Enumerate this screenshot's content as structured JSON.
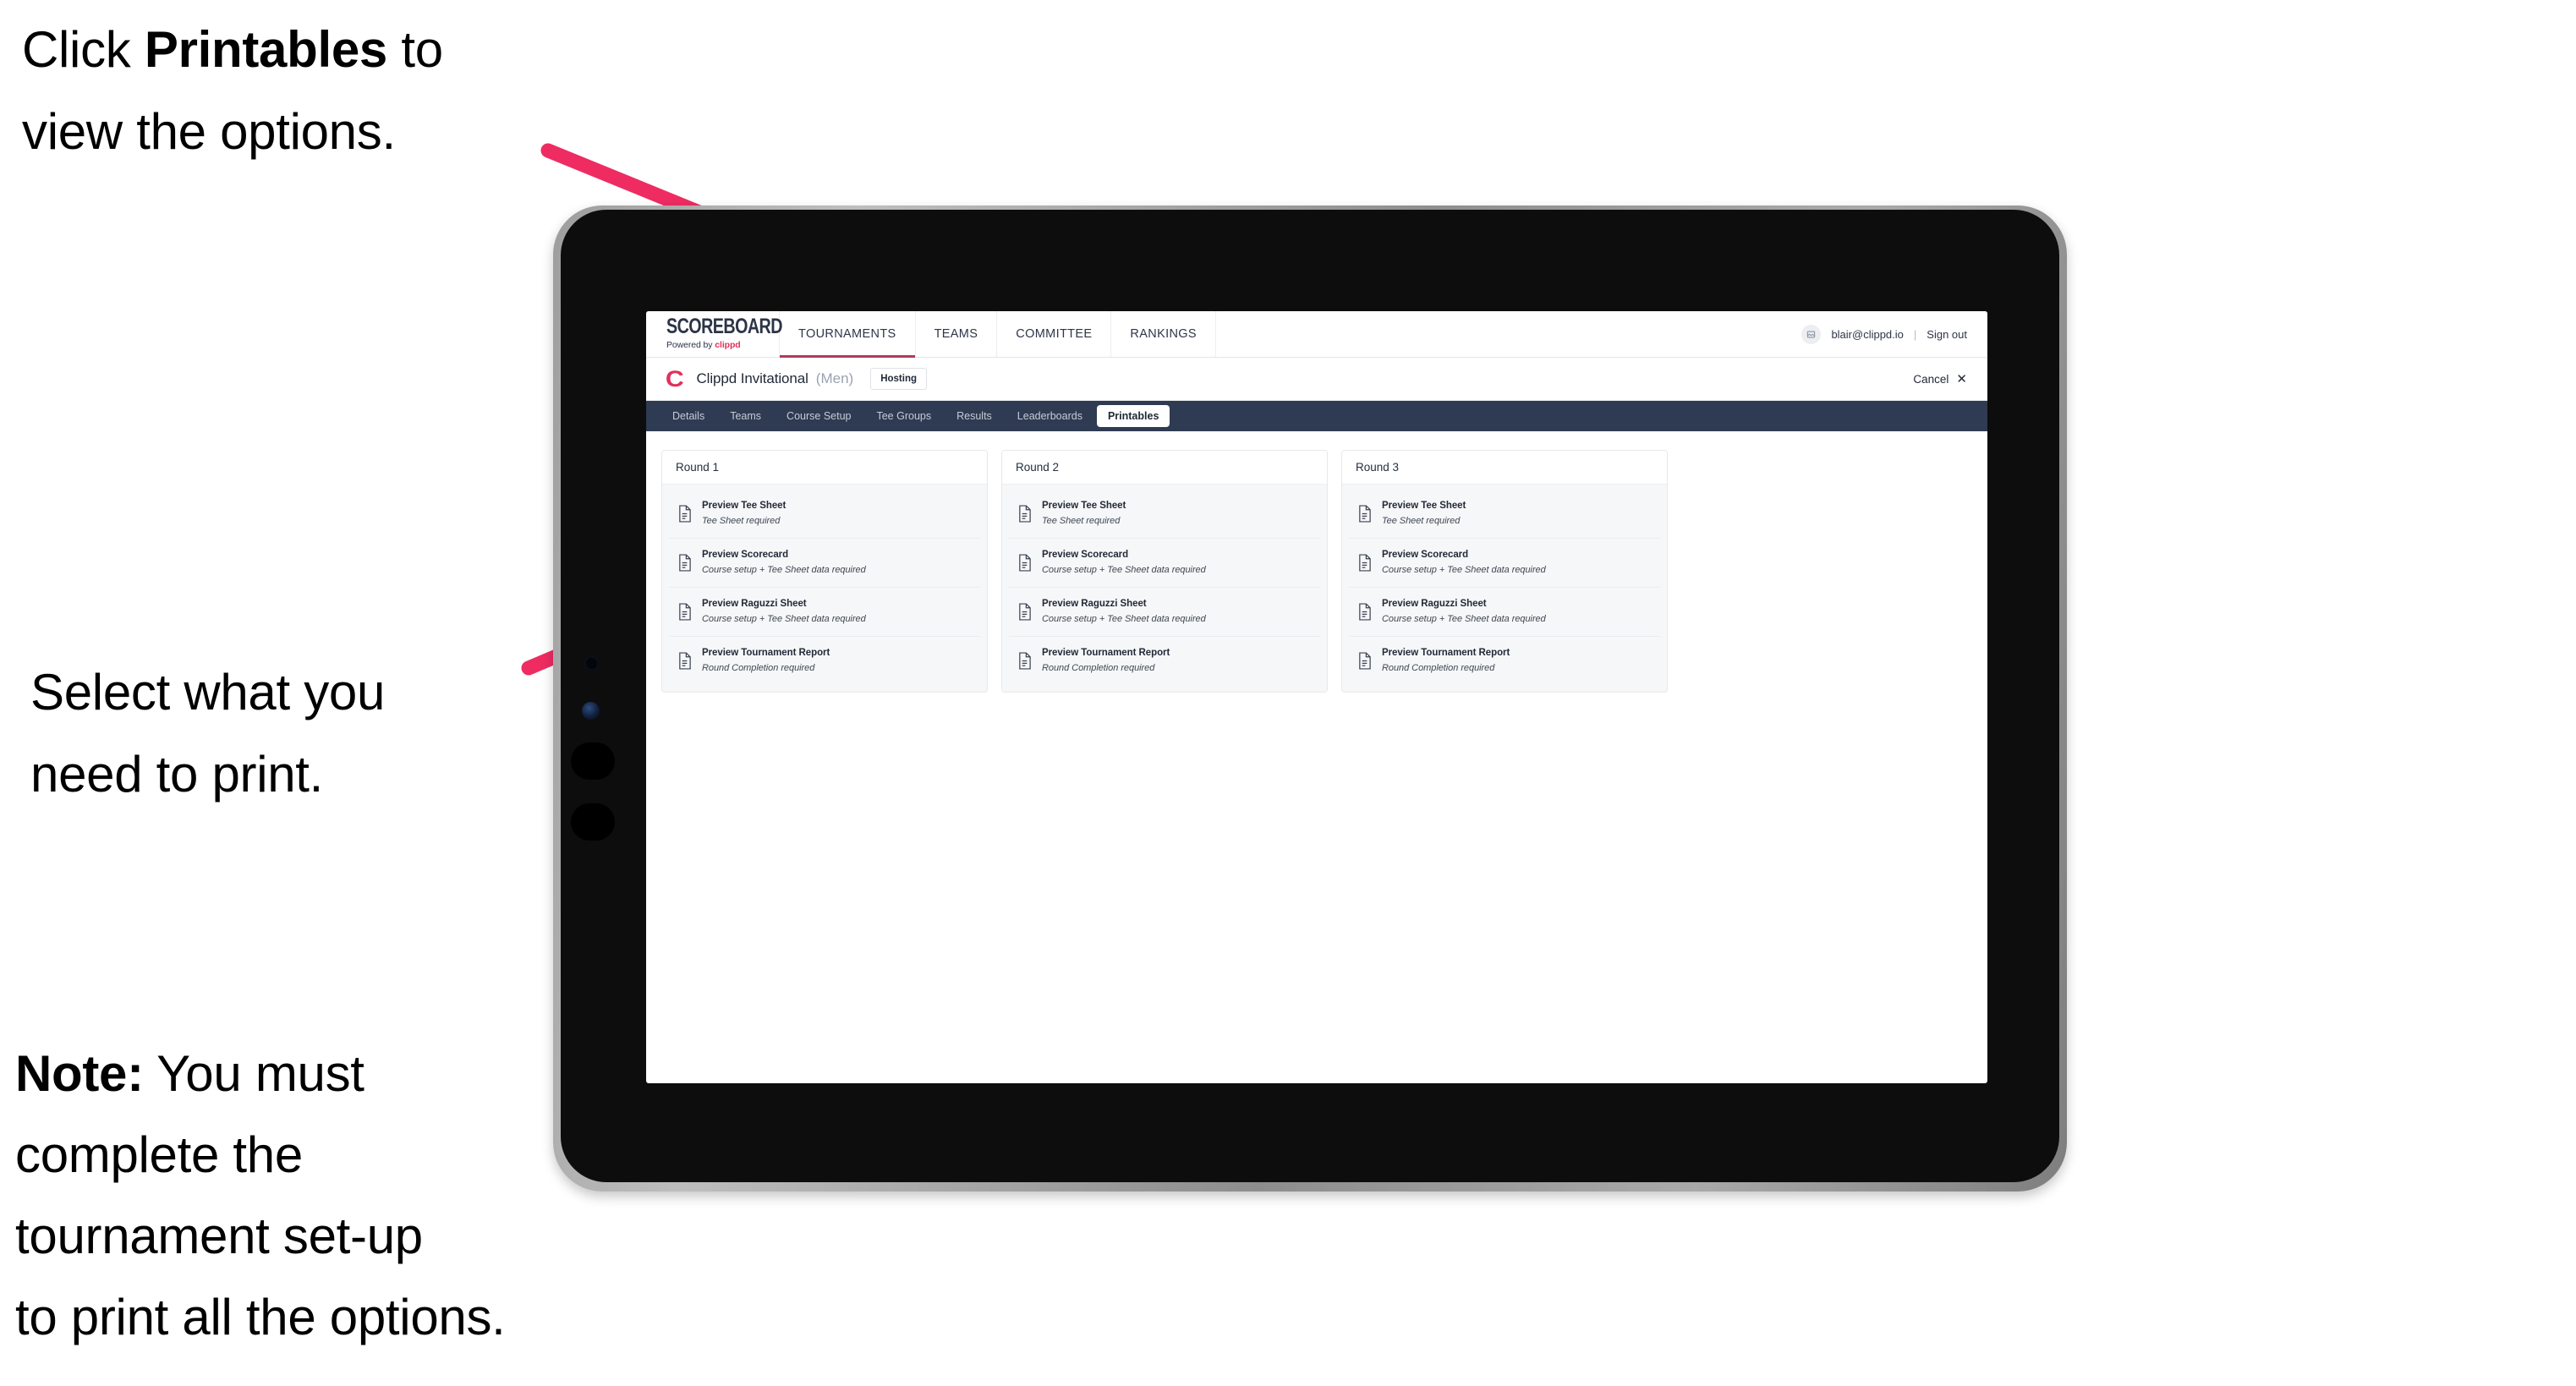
{
  "annotations": [
    {
      "id": "instruction-click-printables",
      "lines": [
        "Click ",
        "Printables",
        " to\nview the options."
      ],
      "prefix": "Click ",
      "bold": "Printables",
      "suffix": " to\nview the options."
    },
    {
      "id": "instruction-select-print",
      "text": "Select what you\n need to print."
    },
    {
      "id": "instruction-note",
      "prefix": "",
      "bold": "Note:",
      "suffix": " You must\ncomplete the\ntournament set-up\nto print all the options."
    }
  ],
  "colors": {
    "arrow": "#EE2C62",
    "brand_pink": "#E0315B",
    "subtab_bar": "#2F3B52",
    "active_nav_underline": "#B23A5D",
    "row_background": "#F6F7F8"
  },
  "app": {
    "brand": {
      "title": "SCOREBOARD",
      "sub_prefix": "Powered by ",
      "sub_brand": "clippd"
    },
    "main_nav": [
      {
        "label": "TOURNAMENTS",
        "active": true
      },
      {
        "label": "TEAMS",
        "active": false
      },
      {
        "label": "COMMITTEE",
        "active": false
      },
      {
        "label": "RANKINGS",
        "active": false
      }
    ],
    "header_right": {
      "avatar_icon": "user-avatar-icon",
      "email": "blair@clippd.io",
      "divider": "|",
      "sign_out": "Sign out"
    },
    "tournament_bar": {
      "logo": "C",
      "name": "Clippd Invitational",
      "gender": "(Men)",
      "status_badge": "Hosting",
      "cancel_label": "Cancel",
      "cancel_icon": "close-x-icon"
    },
    "subtabs": [
      {
        "label": "Details",
        "active": false
      },
      {
        "label": "Teams",
        "active": false
      },
      {
        "label": "Course Setup",
        "active": false
      },
      {
        "label": "Tee Groups",
        "active": false
      },
      {
        "label": "Results",
        "active": false
      },
      {
        "label": "Leaderboards",
        "active": false
      },
      {
        "label": "Printables",
        "active": true
      }
    ],
    "rounds": [
      {
        "title": "Round 1",
        "items": [
          {
            "icon": "document-icon",
            "title": "Preview Tee Sheet",
            "subtitle": "Tee Sheet required"
          },
          {
            "icon": "document-icon",
            "title": "Preview Scorecard",
            "subtitle": "Course setup + Tee Sheet data required"
          },
          {
            "icon": "document-icon",
            "title": "Preview Raguzzi Sheet",
            "subtitle": "Course setup + Tee Sheet data required"
          },
          {
            "icon": "document-icon",
            "title": "Preview Tournament Report",
            "subtitle": "Round Completion required"
          }
        ]
      },
      {
        "title": "Round 2",
        "items": [
          {
            "icon": "document-icon",
            "title": "Preview Tee Sheet",
            "subtitle": "Tee Sheet required"
          },
          {
            "icon": "document-icon",
            "title": "Preview Scorecard",
            "subtitle": "Course setup + Tee Sheet data required"
          },
          {
            "icon": "document-icon",
            "title": "Preview Raguzzi Sheet",
            "subtitle": "Course setup + Tee Sheet data required"
          },
          {
            "icon": "document-icon",
            "title": "Preview Tournament Report",
            "subtitle": "Round Completion required"
          }
        ]
      },
      {
        "title": "Round 3",
        "items": [
          {
            "icon": "document-icon",
            "title": "Preview Tee Sheet",
            "subtitle": "Tee Sheet required"
          },
          {
            "icon": "document-icon",
            "title": "Preview Scorecard",
            "subtitle": "Course setup + Tee Sheet data required"
          },
          {
            "icon": "document-icon",
            "title": "Preview Raguzzi Sheet",
            "subtitle": "Course setup + Tee Sheet data required"
          },
          {
            "icon": "document-icon",
            "title": "Preview Tournament Report",
            "subtitle": "Round Completion required"
          }
        ]
      }
    ]
  }
}
